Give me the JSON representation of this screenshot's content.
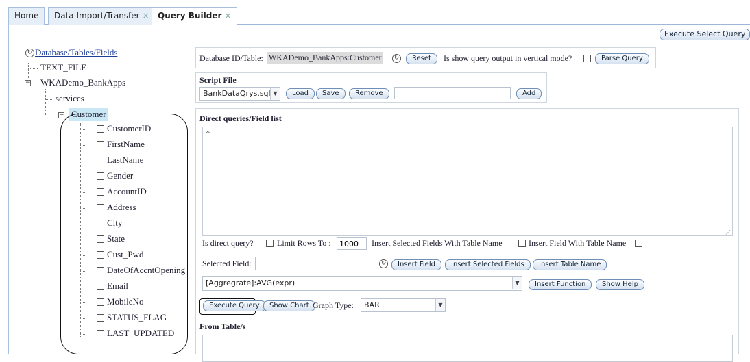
{
  "tabs": [
    {
      "label": "Home",
      "closable": false
    },
    {
      "label": "Data Import/Transfer",
      "closable": true
    },
    {
      "label": "Query Builder",
      "closable": true
    }
  ],
  "toolbar": {
    "execute_select_label": "Execute Select Query"
  },
  "tree": {
    "root_label": "Database/Tables/Fields",
    "nodes": [
      "TEXT_FILE",
      "WKADemo_BankApps",
      "services",
      "Customer"
    ],
    "fields": [
      "CustomerID",
      "FirstName",
      "LastName",
      "Gender",
      "AccountID",
      "Address",
      "City",
      "State",
      "Cust_Pwd",
      "DateOfAccntOpening",
      "Email",
      "MobileNo",
      "STATUS_FLAG",
      "LAST_UPDATED"
    ]
  },
  "dbbar": {
    "label": "Database ID/Table:",
    "value": "WKADemo_BankApps:Customer",
    "reset_label": "Reset",
    "vertical_label": "Is show query output in vertical mode?",
    "parse_label": "Parse Query"
  },
  "script": {
    "title": "Script File",
    "file": "BankDataQrys.sql",
    "load_label": "Load",
    "save_label": "Save",
    "remove_label": "Remove",
    "add_label": "Add"
  },
  "direct": {
    "title": "Direct queries/Field list",
    "query_text": "*",
    "is_direct_label": "Is direct query?",
    "limit_label": "Limit Rows To :",
    "limit_value": "1000",
    "insert_selected_with_table_label": "Insert Selected Fields With Table Name",
    "insert_field_with_table_label": "Insert Field With Table Name",
    "selected_field_label": "Selected Field:",
    "insert_field_label": "Insert Field",
    "insert_selected_fields_label": "Insert Selected Fields",
    "insert_table_name_label": "Insert Table Name",
    "function_value": "[Aggregrate]:AVG(expr)",
    "insert_function_label": "Insert Function",
    "show_help_label": "Show Help",
    "execute_query_label": "Execute Query",
    "show_chart_label": "Show Chart",
    "graph_type_label": "Graph Type:",
    "graph_type_value": "BAR",
    "from_title": "From Table/s"
  },
  "colors": {
    "accent": "#c9e7f4",
    "tab_border": "#a7c0de"
  }
}
